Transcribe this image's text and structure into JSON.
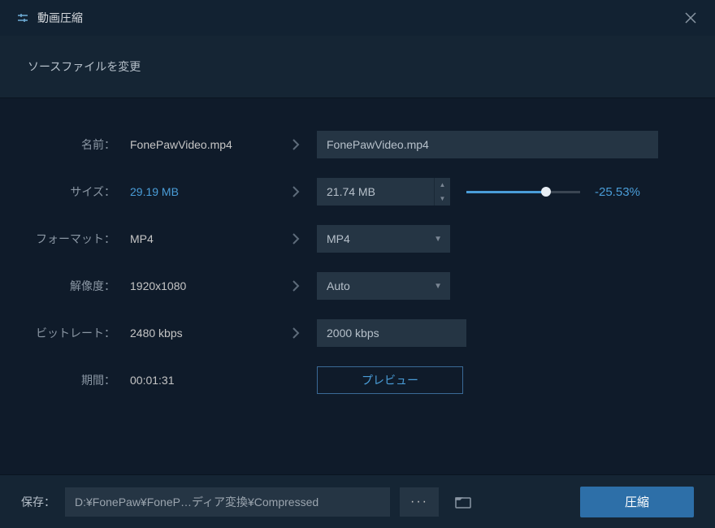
{
  "titlebar": {
    "title": "動画圧縮"
  },
  "subheader": {
    "text": "ソースファイルを変更"
  },
  "form": {
    "name": {
      "label": "名前：",
      "source": "FonePawVideo.mp4",
      "target": "FonePawVideo.mp4"
    },
    "size": {
      "label": "サイズ：",
      "source": "29.19 MB",
      "target": "21.74 MB",
      "percent": "-25.53%"
    },
    "format": {
      "label": "フォーマット：",
      "source": "MP4",
      "target": "MP4"
    },
    "resolution": {
      "label": "解像度：",
      "source": "1920x1080",
      "target": "Auto"
    },
    "bitrate": {
      "label": "ビットレート：",
      "source": "2480 kbps",
      "target": "2000 kbps"
    },
    "duration": {
      "label": "期間：",
      "value": "00:01:31"
    },
    "preview_label": "プレビュー"
  },
  "footer": {
    "save_label": "保存：",
    "path": "D:¥FonePaw¥FoneP…ディア変換¥Compressed",
    "browse": "···",
    "compress_label": "圧縮"
  }
}
